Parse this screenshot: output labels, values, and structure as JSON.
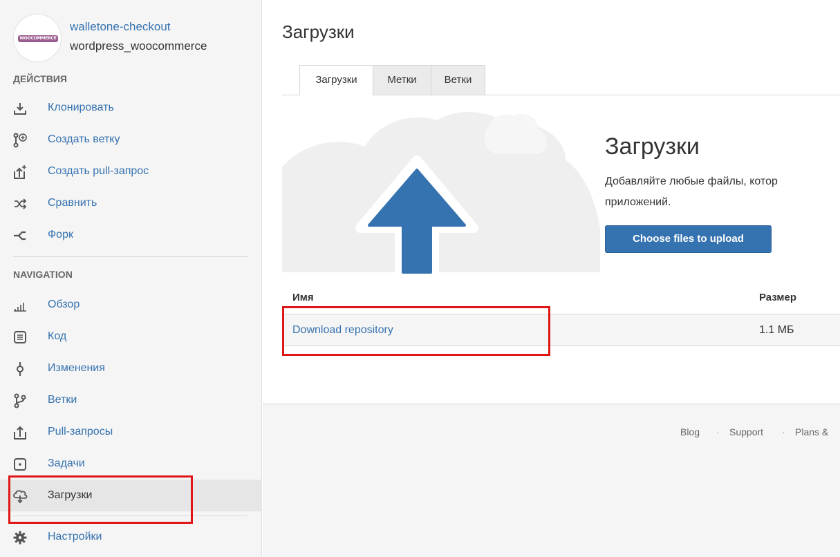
{
  "repo": {
    "owner": "walletone-checkout",
    "name": "wordpress_woocommerce",
    "avatar_text": "WOOCOMMERCE"
  },
  "sidebar": {
    "actions_heading": "ДЕЙСТВИЯ",
    "actions": [
      {
        "label": "Клонировать",
        "icon": "clone-icon"
      },
      {
        "label": "Создать ветку",
        "icon": "create-branch-icon"
      },
      {
        "label": "Создать pull-запрос",
        "icon": "create-pull-request-icon"
      },
      {
        "label": "Сравнить",
        "icon": "compare-icon"
      },
      {
        "label": "Форк",
        "icon": "fork-icon"
      }
    ],
    "navigation_heading": "NAVIGATION",
    "navigation": [
      {
        "label": "Обзор",
        "icon": "overview-icon"
      },
      {
        "label": "Код",
        "icon": "code-icon"
      },
      {
        "label": "Изменения",
        "icon": "commits-icon"
      },
      {
        "label": "Ветки",
        "icon": "branches-icon"
      },
      {
        "label": "Pull-запросы",
        "icon": "pull-requests-icon"
      },
      {
        "label": "Задачи",
        "icon": "issues-icon"
      },
      {
        "label": "Загрузки",
        "icon": "downloads-icon",
        "active": true
      }
    ],
    "settings": {
      "label": "Настройки",
      "icon": "settings-gear-icon"
    }
  },
  "main": {
    "title": "Загрузки",
    "tabs": [
      {
        "label": "Загрузки",
        "selected": true
      },
      {
        "label": "Метки",
        "selected": false
      },
      {
        "label": "Ветки",
        "selected": false
      }
    ],
    "hero": {
      "title": "Загрузки",
      "description": "Добавляйте любые файлы, котор приложений.",
      "upload_button": "Choose files to upload"
    },
    "table": {
      "columns": [
        "Имя",
        "Размер"
      ],
      "rows": [
        {
          "name": "Download repository",
          "size": "1.1 МБ"
        }
      ]
    }
  },
  "footer": {
    "links": [
      "Blog",
      "Support",
      "Plans &"
    ],
    "separator": "·"
  },
  "colors": {
    "link": "#3572b0",
    "button": "#3572b0",
    "highlight": "#e01616",
    "cloud": "#efefef"
  }
}
